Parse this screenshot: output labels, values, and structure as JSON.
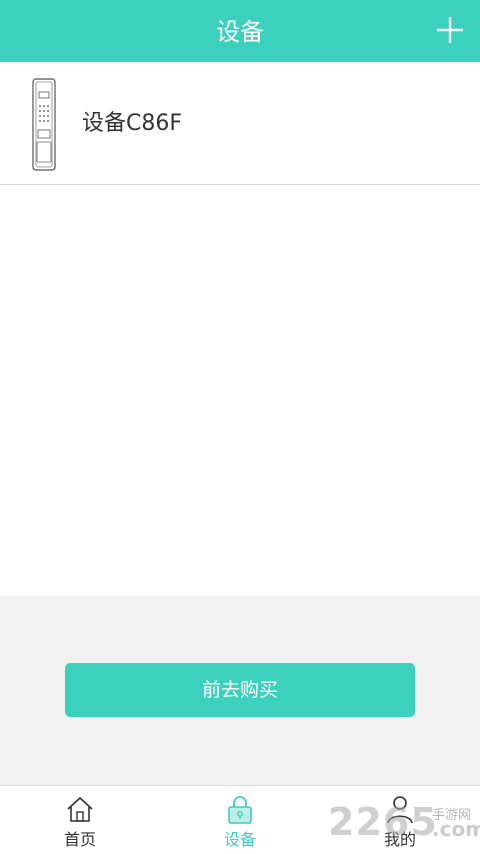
{
  "header": {
    "title": "设备"
  },
  "device": {
    "name": "设备C86F"
  },
  "actions": {
    "buy_label": "前去购买"
  },
  "tabs": [
    {
      "label": "首页",
      "icon": "home-icon"
    },
    {
      "label": "设备",
      "icon": "lock-icon",
      "active": true
    },
    {
      "label": "我的",
      "icon": "user-icon"
    }
  ],
  "watermark": {
    "number": "2265",
    "text": "手游网",
    "suffix": ".com"
  },
  "colors": {
    "accent": "#3bd1bd",
    "gray_bg": "#f2f2f2",
    "text": "#333333"
  }
}
